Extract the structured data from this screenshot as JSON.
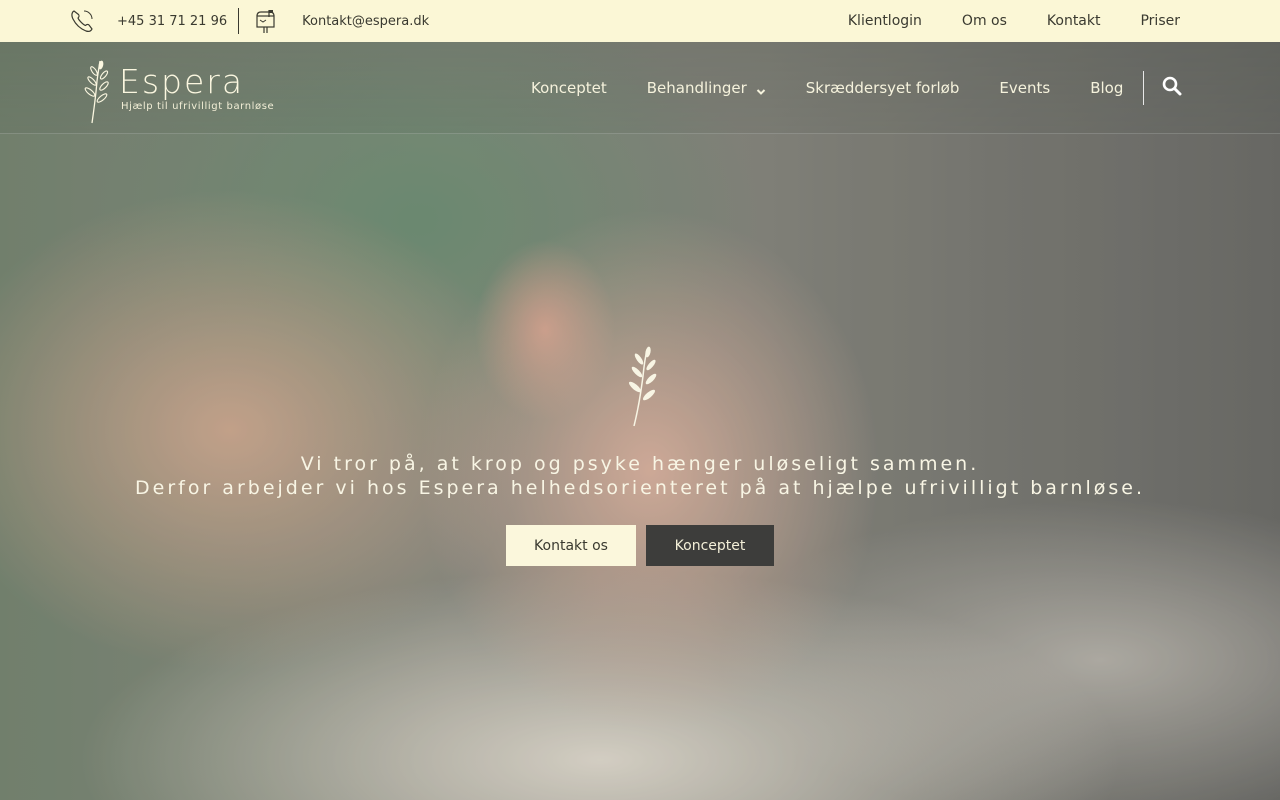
{
  "topbar": {
    "phone": "+45 31 71 21 96",
    "email": "Kontakt@espera.dk",
    "links": [
      "Klientlogin",
      "Om os",
      "Kontakt",
      "Priser"
    ],
    "icons": [
      "phone-icon",
      "mailbox-icon"
    ]
  },
  "brand": {
    "name": "Espera",
    "tagline": "Hjælp til ufrivilligt barnløse"
  },
  "nav": {
    "items": [
      "Konceptet",
      "Behandlinger",
      "Skræddersyet forløb",
      "Events",
      "Blog"
    ],
    "dropdown_icon": "chevron-down-icon",
    "search_icon": "search-icon"
  },
  "hero": {
    "line1": "Vi tror på, at krop og psyke hænger uløseligt sammen.",
    "line2": "Derfor arbejder vi hos Espera helhedsorienteret på at hjælpe ufrivilligt barnløse.",
    "buttons": {
      "primary": "Kontakt os",
      "secondary": "Konceptet"
    }
  },
  "colors": {
    "cream": "#fbf7d6",
    "dark_button": "#3d3d3b",
    "text_dark": "#3a3a30"
  }
}
